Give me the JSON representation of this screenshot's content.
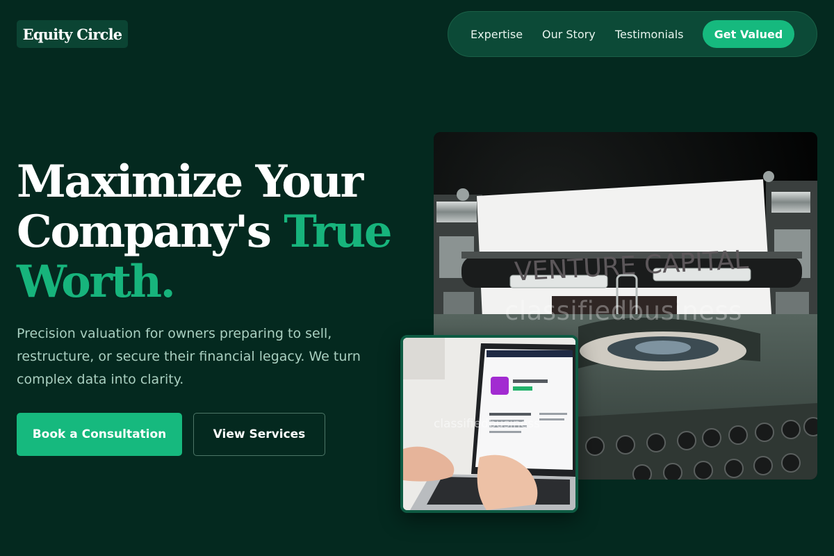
{
  "header": {
    "logo_text": "Equity Circle",
    "nav": [
      {
        "label": "Expertise"
      },
      {
        "label": "Our Story"
      },
      {
        "label": "Testimonials"
      }
    ],
    "cta_label": "Get Valued"
  },
  "hero": {
    "title_line1": "Maximize Your",
    "title_line2_white": "Company's",
    "title_line2_accent": "True",
    "title_line3_accent": "Worth.",
    "subtitle": "Precision valuation for owners preparing to sell, restructure, or secure their financial legacy. We turn complex data into clarity.",
    "primary_button": "Book a Consultation",
    "secondary_button": "View Services"
  },
  "images": {
    "main_photo": {
      "paper_text": "VENTURE CAPITAL",
      "watermark": "classifiedbusiness"
    },
    "small_photo": {
      "watermark": "classifiedbusiness"
    }
  },
  "colors": {
    "background": "#04291f",
    "accent": "#16b97e",
    "nav_background": "#0c4a37",
    "logo_background": "#0b4433",
    "subtitle_text": "#a9cfc0"
  }
}
